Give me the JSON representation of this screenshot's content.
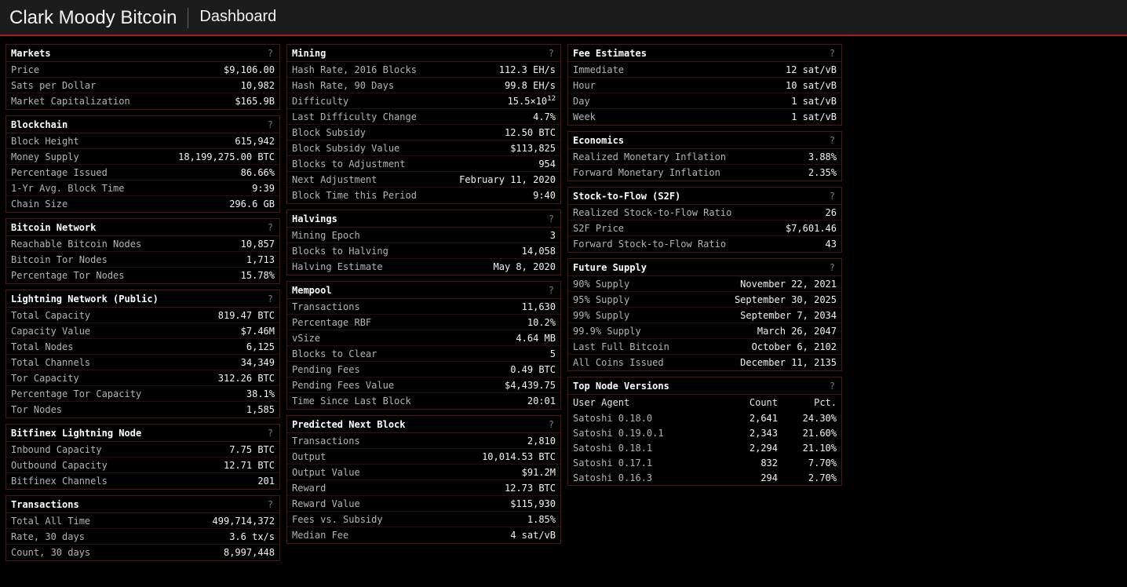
{
  "header": {
    "brand": "Clark Moody Bitcoin",
    "title": "Dashboard"
  },
  "help_label": "?",
  "markets": {
    "title": "Markets",
    "rows": [
      {
        "k": "Price",
        "v": "$9,106.00"
      },
      {
        "k": "Sats per Dollar",
        "v": "10,982"
      },
      {
        "k": "Market Capitalization",
        "v": "$165.9B"
      }
    ]
  },
  "blockchain": {
    "title": "Blockchain",
    "rows": [
      {
        "k": "Block Height",
        "v": "615,942"
      },
      {
        "k": "Money Supply",
        "v": "18,199,275.00 BTC"
      },
      {
        "k": "Percentage Issued",
        "v": "86.66%"
      },
      {
        "k": "1-Yr Avg. Block Time",
        "v": "9:39"
      },
      {
        "k": "Chain Size",
        "v": "296.6 GB"
      }
    ]
  },
  "bitcoin_network": {
    "title": "Bitcoin Network",
    "rows": [
      {
        "k": "Reachable Bitcoin Nodes",
        "v": "10,857"
      },
      {
        "k": "Bitcoin Tor Nodes",
        "v": "1,713"
      },
      {
        "k": "Percentage Tor Nodes",
        "v": "15.78%"
      }
    ]
  },
  "lightning": {
    "title": "Lightning Network (Public)",
    "rows": [
      {
        "k": "Total Capacity",
        "v": "819.47 BTC"
      },
      {
        "k": "Capacity Value",
        "v": "$7.46M"
      },
      {
        "k": "Total Nodes",
        "v": "6,125"
      },
      {
        "k": "Total Channels",
        "v": "34,349"
      },
      {
        "k": "Tor Capacity",
        "v": "312.26 BTC"
      },
      {
        "k": "Percentage Tor Capacity",
        "v": "38.1%"
      },
      {
        "k": "Tor Nodes",
        "v": "1,585"
      }
    ]
  },
  "bitfinex": {
    "title": "Bitfinex Lightning Node",
    "rows": [
      {
        "k": "Inbound Capacity",
        "v": "7.75 BTC"
      },
      {
        "k": "Outbound Capacity",
        "v": "12.71 BTC"
      },
      {
        "k": "Bitfinex Channels",
        "v": "201"
      }
    ]
  },
  "transactions": {
    "title": "Transactions",
    "rows": [
      {
        "k": "Total All Time",
        "v": "499,714,372"
      },
      {
        "k": "Rate, 30 days",
        "v": "3.6 tx/s"
      },
      {
        "k": "Count, 30 days",
        "v": "8,997,448"
      }
    ]
  },
  "mining": {
    "title": "Mining",
    "hash_2016": {
      "k": "Hash Rate, 2016 Blocks",
      "v": "112.3 EH/s"
    },
    "hash_90": {
      "k": "Hash Rate, 90 Days",
      "v": "99.8 EH/s"
    },
    "difficulty": {
      "k": "Difficulty",
      "base": "15.5×10",
      "exp": "12"
    },
    "rows": [
      {
        "k": "Last Difficulty Change",
        "v": "4.7%"
      },
      {
        "k": "Block Subsidy",
        "v": "12.50 BTC"
      },
      {
        "k": "Block Subsidy Value",
        "v": "$113,825"
      },
      {
        "k": "Blocks to Adjustment",
        "v": "954"
      },
      {
        "k": "Next Adjustment",
        "v": "February 11, 2020"
      },
      {
        "k": "Block Time this Period",
        "v": "9:40"
      }
    ]
  },
  "halvings": {
    "title": "Halvings",
    "rows": [
      {
        "k": "Mining Epoch",
        "v": "3"
      },
      {
        "k": "Blocks to Halving",
        "v": "14,058"
      },
      {
        "k": "Halving Estimate",
        "v": "May 8, 2020"
      }
    ]
  },
  "mempool": {
    "title": "Mempool",
    "rows": [
      {
        "k": "Transactions",
        "v": "11,630"
      },
      {
        "k": "Percentage RBF",
        "v": "10.2%"
      },
      {
        "k": "vSize",
        "v": "4.64 MB"
      },
      {
        "k": "Blocks to Clear",
        "v": "5"
      },
      {
        "k": "Pending Fees",
        "v": "0.49 BTC"
      },
      {
        "k": "Pending Fees Value",
        "v": "$4,439.75"
      },
      {
        "k": "Time Since Last Block",
        "v": "20:01"
      }
    ]
  },
  "next_block": {
    "title": "Predicted Next Block",
    "rows": [
      {
        "k": "Transactions",
        "v": "2,810"
      },
      {
        "k": "Output",
        "v": "10,014.53 BTC"
      },
      {
        "k": "Output Value",
        "v": "$91.2M"
      },
      {
        "k": "Reward",
        "v": "12.73 BTC"
      },
      {
        "k": "Reward Value",
        "v": "$115,930"
      },
      {
        "k": "Fees vs. Subsidy",
        "v": "1.85%"
      },
      {
        "k": "Median Fee",
        "v": "4 sat/vB"
      }
    ]
  },
  "fees": {
    "title": "Fee Estimates",
    "rows": [
      {
        "k": "Immediate",
        "v": "12 sat/vB"
      },
      {
        "k": "Hour",
        "v": "10 sat/vB"
      },
      {
        "k": "Day",
        "v": "1 sat/vB"
      },
      {
        "k": "Week",
        "v": "1 sat/vB"
      }
    ]
  },
  "economics": {
    "title": "Economics",
    "rows": [
      {
        "k": "Realized Monetary Inflation",
        "v": "3.88%"
      },
      {
        "k": "Forward Monetary Inflation",
        "v": "2.35%"
      }
    ]
  },
  "s2f": {
    "title": "Stock-to-Flow (S2F)",
    "rows": [
      {
        "k": "Realized Stock-to-Flow Ratio",
        "v": "26"
      },
      {
        "k": "S2F Price",
        "v": "$7,601.46"
      },
      {
        "k": "Forward Stock-to-Flow Ratio",
        "v": "43"
      }
    ]
  },
  "future_supply": {
    "title": "Future Supply",
    "rows": [
      {
        "k": "90% Supply",
        "v": "November 22, 2021"
      },
      {
        "k": "95% Supply",
        "v": "September 30, 2025"
      },
      {
        "k": "99% Supply",
        "v": "September 7, 2034"
      },
      {
        "k": "99.9% Supply",
        "v": "March 26, 2047"
      },
      {
        "k": "Last Full Bitcoin",
        "v": "October 6, 2102"
      },
      {
        "k": "All Coins Issued",
        "v": "December 11, 2135"
      }
    ]
  },
  "node_versions": {
    "title": "Top Node Versions",
    "columns": {
      "agent": "User Agent",
      "count": "Count",
      "pct": "Pct."
    },
    "rows": [
      {
        "agent": "Satoshi 0.18.0",
        "count": "2,641",
        "pct": "24.30%"
      },
      {
        "agent": "Satoshi 0.19.0.1",
        "count": "2,343",
        "pct": "21.60%"
      },
      {
        "agent": "Satoshi 0.18.1",
        "count": "2,294",
        "pct": "21.10%"
      },
      {
        "agent": "Satoshi 0.17.1",
        "count": "832",
        "pct": "7.70%"
      },
      {
        "agent": "Satoshi 0.16.3",
        "count": "294",
        "pct": "2.70%"
      }
    ]
  }
}
